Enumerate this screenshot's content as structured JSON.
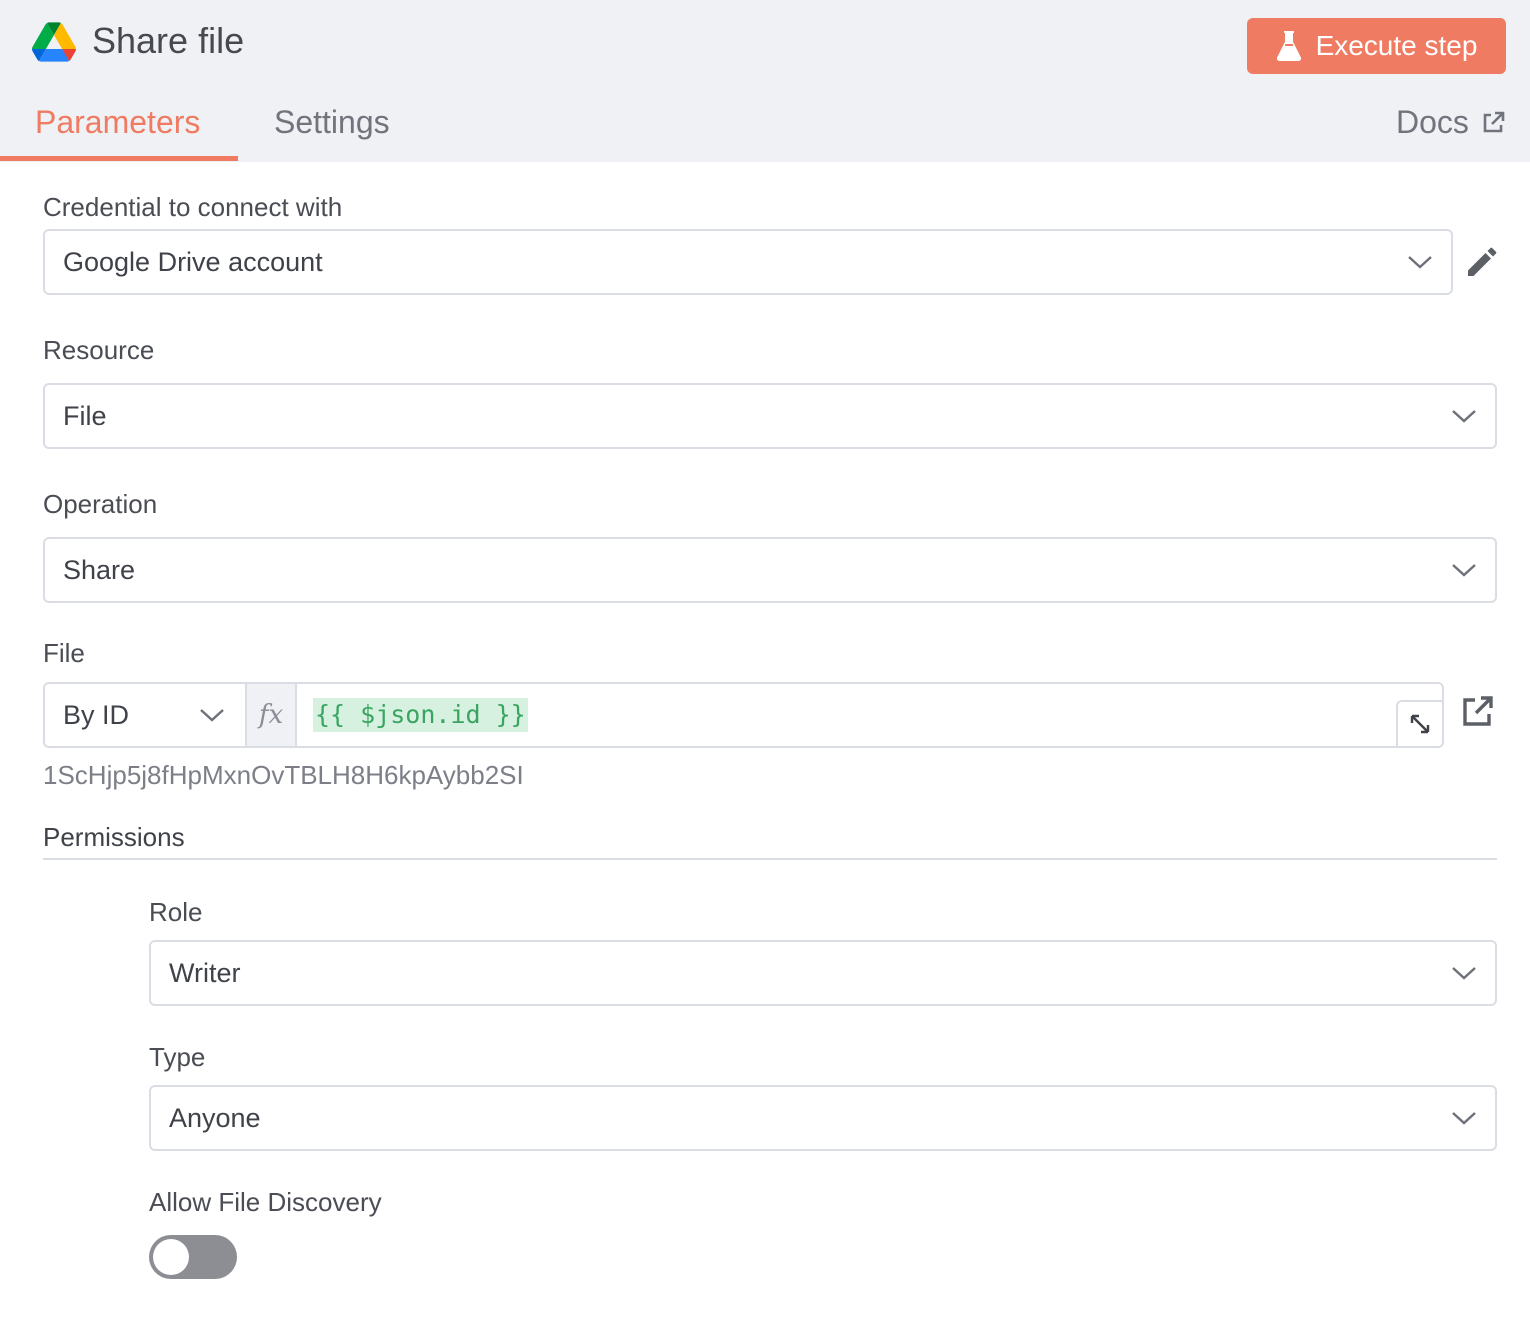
{
  "header": {
    "title": "Share file",
    "execute_label": "Execute step",
    "logo_icon": "google-drive-icon"
  },
  "tabs": [
    {
      "label": "Parameters",
      "active": true
    },
    {
      "label": "Settings",
      "active": false
    }
  ],
  "docs_label": "Docs",
  "fields": {
    "credential": {
      "label": "Credential to connect with",
      "value": "Google Drive account"
    },
    "resource": {
      "label": "Resource",
      "value": "File"
    },
    "operation": {
      "label": "Operation",
      "value": "Share"
    },
    "file": {
      "label": "File",
      "mode": "By ID",
      "fx": "fx",
      "expression": "{{ $json.id }}",
      "resolved_value": "1ScHjp5j8fHpMxnOvTBLH8H6kpAybb2SI"
    }
  },
  "permissions": {
    "title": "Permissions",
    "role": {
      "label": "Role",
      "value": "Writer"
    },
    "type": {
      "label": "Type",
      "value": "Anyone"
    },
    "allow_file_discovery": {
      "label": "Allow File Discovery",
      "enabled": false
    }
  },
  "colors": {
    "accent": "#ef7b62",
    "header_bg": "#eff1f5",
    "expression_bg": "#d6f1df",
    "expression_text": "#3aa561",
    "toggle_off": "#8c8e93"
  }
}
